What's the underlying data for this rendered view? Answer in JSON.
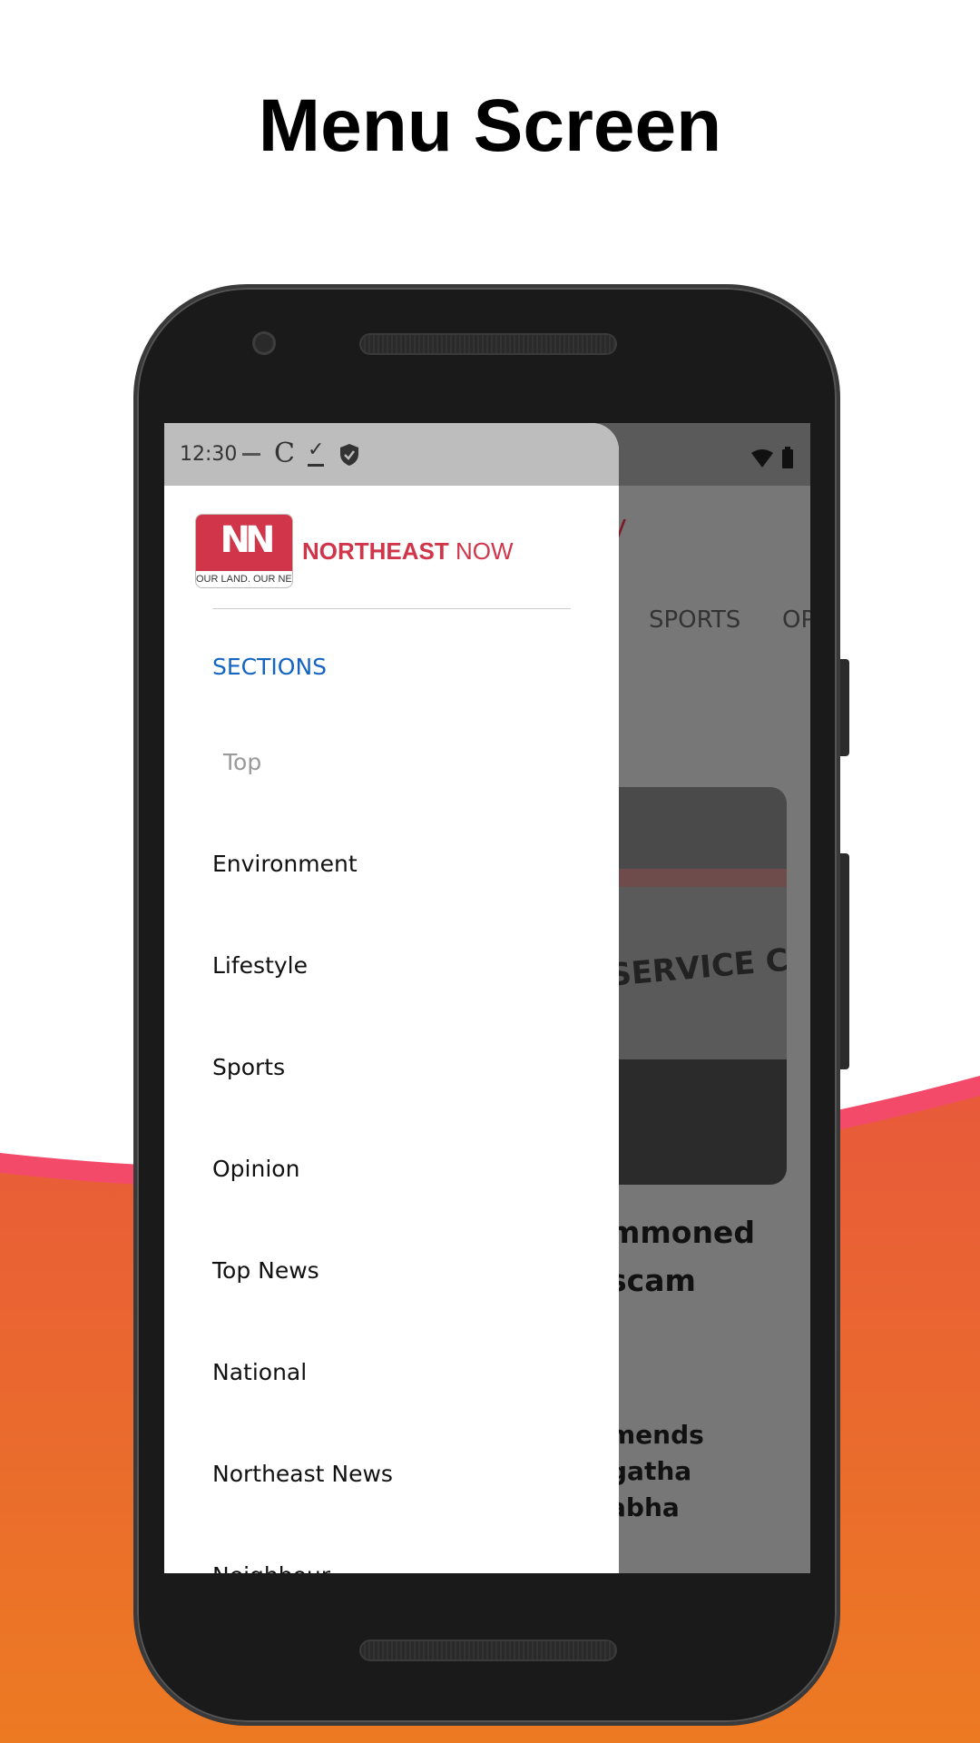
{
  "page_title": "Menu Screen",
  "colors": {
    "accent_blue": "#1565c0",
    "brand_red": "#d0354a",
    "orange_top": "#e85a3a",
    "orange_bottom": "#ec7a22",
    "stripe_pink": "#f44a6a"
  },
  "status_bar": {
    "time": "12:30",
    "icons": [
      "notification-icon",
      "c-app-icon",
      "download-done-icon",
      "shield-check-icon",
      "wifi-icon",
      "battery-icon"
    ]
  },
  "drawer": {
    "logo": {
      "brand_bold": "NORTHEAST",
      "brand_light": "NOW",
      "badge_text": "NORTHEAST NOW",
      "tagline": "OUR LAND. OUR NEWS"
    },
    "section_header": "SECTIONS",
    "items": [
      {
        "label": "Top",
        "selected": true
      },
      {
        "label": "Environment"
      },
      {
        "label": "Lifestyle"
      },
      {
        "label": "Sports"
      },
      {
        "label": "Opinion"
      },
      {
        "label": "Top News"
      },
      {
        "label": "National"
      },
      {
        "label": "Northeast News"
      },
      {
        "label": "Neighbour"
      }
    ]
  },
  "background": {
    "logo_fragment": "V",
    "tabs": [
      "SPORTS",
      "OP"
    ],
    "image_text": "SERVICE COMM",
    "headline1": [
      "mmoned",
      "scam"
    ],
    "headline2": [
      "mends",
      "gatha",
      "abha"
    ]
  }
}
